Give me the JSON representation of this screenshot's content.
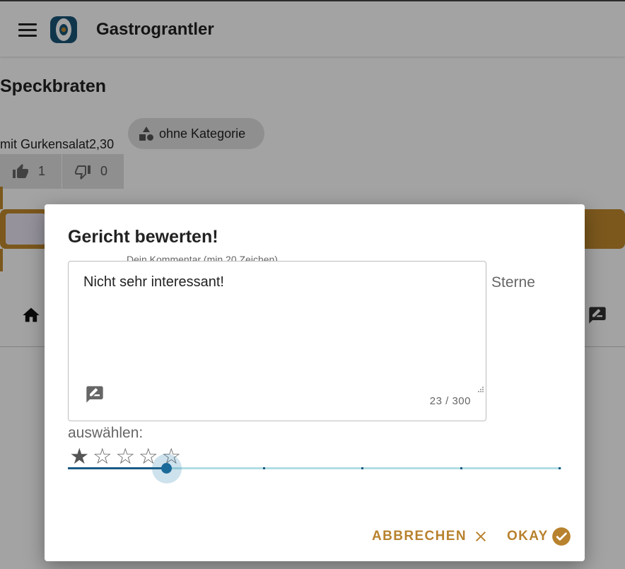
{
  "app": {
    "title": "Gastrograntler",
    "menu_icon": "menu-icon",
    "logo_icon": "app-logo",
    "brand_color": "#c28a2e"
  },
  "dish": {
    "name": "Speckbraten",
    "subtitle": "mit Gurkensalat2,30",
    "category_chip": {
      "label": "ohne Kategorie",
      "icon": "category-shapes-icon"
    },
    "votes": {
      "up": {
        "count": "1",
        "icon": "thumb-up-icon"
      },
      "down": {
        "count": "0",
        "icon": "thumb-down-icon"
      }
    }
  },
  "bottom_nav": {
    "left_icon": "home-icon",
    "right_icon": "rate-review-icon"
  },
  "dialog": {
    "title": "Gericht bewerten!",
    "comment": {
      "label": "Dein Kommentar (min 20 Zeichen)",
      "value": "Nicht sehr interessant!",
      "counter": "23 / 300",
      "icon": "rate-review-icon"
    },
    "rating": {
      "label_line1": "Sterne",
      "label_line2": "auswählen:",
      "value": 1,
      "max": 5,
      "stars": [
        "★",
        "☆",
        "☆",
        "☆",
        "☆"
      ],
      "slider_fraction": 0.2,
      "accent_color": "#1a6a9a"
    },
    "actions": {
      "cancel_label": "ABBRECHEN",
      "cancel_icon": "close-icon",
      "ok_label": "OKAY",
      "ok_icon": "check-circle-icon"
    }
  }
}
